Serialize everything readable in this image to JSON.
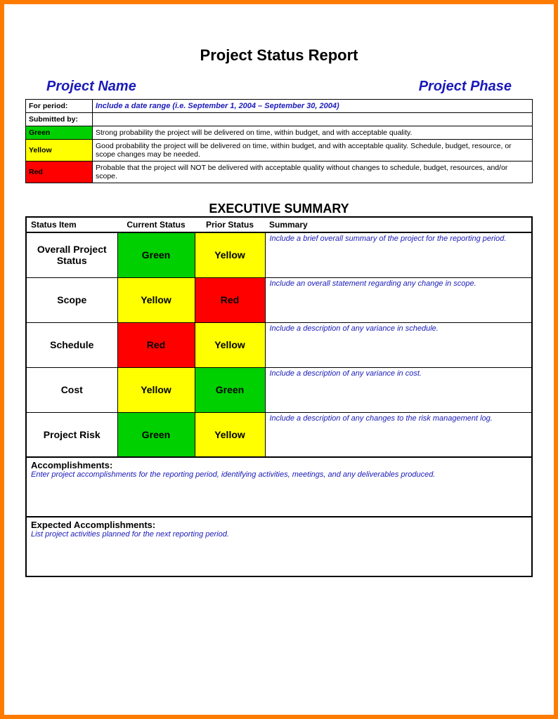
{
  "title": "Project Status Report",
  "subhead": {
    "left": "Project Name",
    "right": "Project Phase"
  },
  "colors": {
    "green": "#00d000",
    "yellow": "#ffff00",
    "red": "#ff0000"
  },
  "top": {
    "for_period_label": "For period:",
    "for_period_value": "Include a date range (i.e. September 1, 2004 – September 30, 2004)",
    "submitted_by_label": "Submitted by:",
    "legend": [
      {
        "name": "Green",
        "color": "green",
        "desc": "Strong probability the project will be delivered on time, within budget, and with acceptable quality."
      },
      {
        "name": "Yellow",
        "color": "yellow",
        "desc": "Good probability the project will be delivered on time, within budget, and with acceptable quality. Schedule, budget, resource, or scope changes may be needed."
      },
      {
        "name": "Red",
        "color": "red",
        "desc": "Probable that the project will NOT be delivered with acceptable quality without changes to schedule, budget, resources, and/or scope."
      }
    ]
  },
  "exec_title": "EXECUTIVE SUMMARY",
  "exec_headers": {
    "item": "Status Item",
    "current": "Current Status",
    "prior": "Prior Status",
    "summary": "Summary"
  },
  "exec_rows": [
    {
      "item": "Overall Project Status",
      "current": "Green",
      "prior": "Yellow",
      "summary": "Include a brief overall summary of the project for the reporting period."
    },
    {
      "item": "Scope",
      "current": "Yellow",
      "prior": "Red",
      "summary": "Include an overall statement regarding any change in scope."
    },
    {
      "item": "Schedule",
      "current": "Red",
      "prior": "Yellow",
      "summary": "Include a description of any variance in schedule."
    },
    {
      "item": "Cost",
      "current": "Yellow",
      "prior": "Green",
      "summary": "Include a description of any variance in cost."
    },
    {
      "item": "Project Risk",
      "current": "Green",
      "prior": "Yellow",
      "summary": "Include a description of any changes to the risk management log."
    }
  ],
  "accomplishments": {
    "label": "Accomplishments:",
    "body": "Enter project accomplishments for the reporting period, identifying activities, meetings, and any deliverables produced."
  },
  "expected": {
    "label": "Expected Accomplishments:",
    "body": "List project activities planned for the next reporting period."
  }
}
